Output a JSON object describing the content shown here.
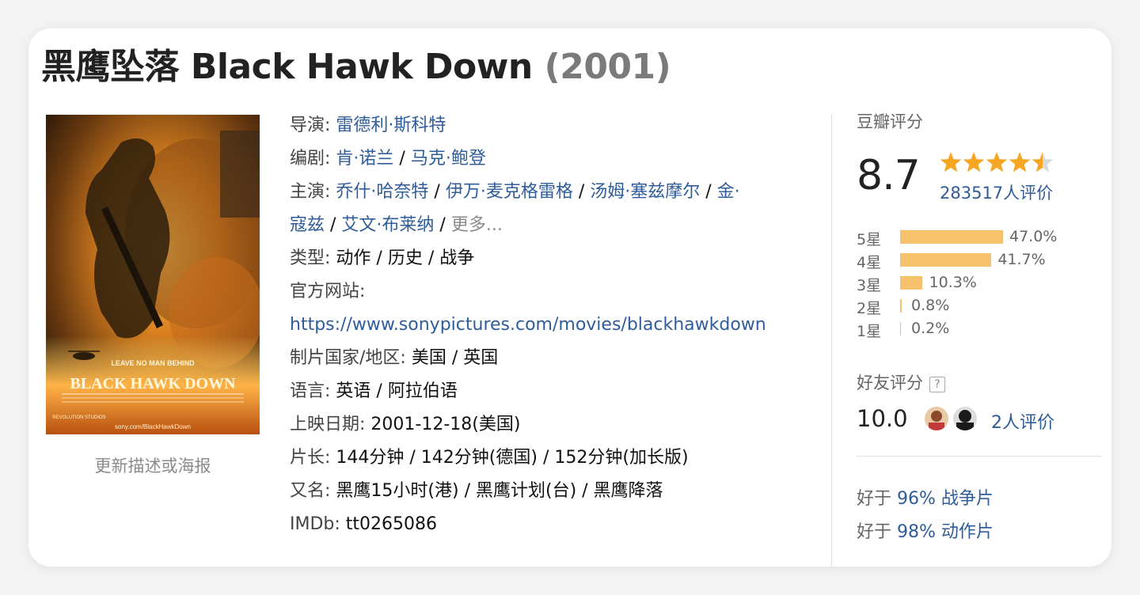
{
  "title": {
    "main": "黑鹰坠落 Black Hawk Down",
    "year": "(2001)"
  },
  "poster": {
    "tagline": "LEAVE NO MAN BEHIND",
    "film_title": "BLACK HAWK DOWN",
    "studio": "REVOLUTION STUDIOS",
    "url": "sony.com/BlackHawkDown",
    "update_link": "更新描述或海报"
  },
  "info": {
    "director_label": "导演:",
    "director": "雷德利·斯科特",
    "writer_label": "编剧:",
    "writers": [
      "肯·诺兰",
      "马克·鲍登"
    ],
    "cast_label": "主演:",
    "cast_line1": [
      "乔什·哈奈特",
      "伊万·麦克格雷格",
      "汤姆·塞兹摩尔"
    ],
    "cast_split_a": "金·",
    "cast_split_b": "寇兹",
    "cast_line2_rest": "艾文·布莱纳",
    "more": "更多...",
    "sep": " / ",
    "genre_label": "类型:",
    "genres": "动作 / 历史 / 战争",
    "site_label": "官方网站:",
    "site_url": "https://www.sonypictures.com/movies/blackhawkdown",
    "country_label": "制片国家/地区:",
    "country": "美国 / 英国",
    "language_label": "语言:",
    "language": "英语 / 阿拉伯语",
    "release_label": "上映日期:",
    "release": "2001-12-18(美国)",
    "runtime_label": "片长:",
    "runtime": "144分钟 / 142分钟(德国) / 152分钟(加长版)",
    "aka_label": "又名:",
    "aka": "黑鹰15小时(港) / 黑鹰计划(台) / 黑鹰降落",
    "imdb_label": "IMDb:",
    "imdb": "tt0265086"
  },
  "rating": {
    "header": "豆瓣评分",
    "score": "8.7",
    "stars_value": 4.5,
    "stars_max": 5,
    "votes": "283517人评价",
    "distribution": [
      {
        "label": "5星",
        "pct": "47.0%",
        "value": 47.0
      },
      {
        "label": "4星",
        "pct": "41.7%",
        "value": 41.7
      },
      {
        "label": "3星",
        "pct": "10.3%",
        "value": 10.3
      },
      {
        "label": "2星",
        "pct": "0.8%",
        "value": 0.8
      },
      {
        "label": "1星",
        "pct": "0.2%",
        "value": 0.2
      }
    ],
    "bar_color": "#f5c26b",
    "star_color": "#f5a623"
  },
  "friends": {
    "header": "好友评分",
    "help": "?",
    "score": "10.0",
    "votes": "2人评价"
  },
  "better_than": [
    {
      "prefix": "好于",
      "pct": "96%",
      "genre": "战争片"
    },
    {
      "prefix": "好于",
      "pct": "98%",
      "genre": "动作片"
    }
  ],
  "colors": {
    "link": "#2f5c9a",
    "muted": "#8a8a8a"
  }
}
